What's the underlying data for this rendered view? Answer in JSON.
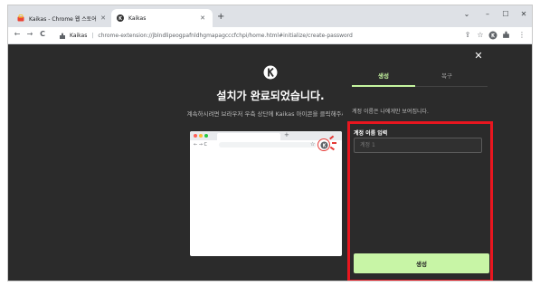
{
  "browser": {
    "tabs": [
      {
        "title": "Kaikas - Chrome 웹 스토어",
        "active": false
      },
      {
        "title": "Kaikas",
        "active": true
      }
    ],
    "new_tab_symbol": "+",
    "window_controls": {
      "collapse": "⌄",
      "minimize": "–",
      "maximize": "☐",
      "close": "✕"
    },
    "address": {
      "site_name": "Kaikas",
      "url": "chrome-extension://jblndlipeogpafnldhgmapagcccfchpi/home.html#initialize/create-password"
    },
    "nav": {
      "back": "←",
      "forward": "→",
      "reload": "C"
    },
    "toolbar_icons": [
      "share-icon",
      "star-icon",
      "kaikas-extension-icon",
      "puzzle-icon",
      "more-icon"
    ]
  },
  "main": {
    "heading": "설치가 완료되었습니다.",
    "subtext": "계속하시려면 브라우저 우측 상단에 Kaikas 아이콘을 클릭해주세요."
  },
  "panel": {
    "close_symbol": "✕",
    "tabs": [
      {
        "label": "생성",
        "active": true
      },
      {
        "label": "복구",
        "active": false
      }
    ],
    "description": "계정 이름은 나에게만 보여집니다.",
    "field_label": "계정 이름 입력",
    "field_placeholder": "계정 1",
    "field_value": "",
    "submit_label": "생성"
  },
  "colors": {
    "accent": "#c8f5a6",
    "highlight_border": "#e8161f",
    "page_bg": "#2b2b2b"
  }
}
